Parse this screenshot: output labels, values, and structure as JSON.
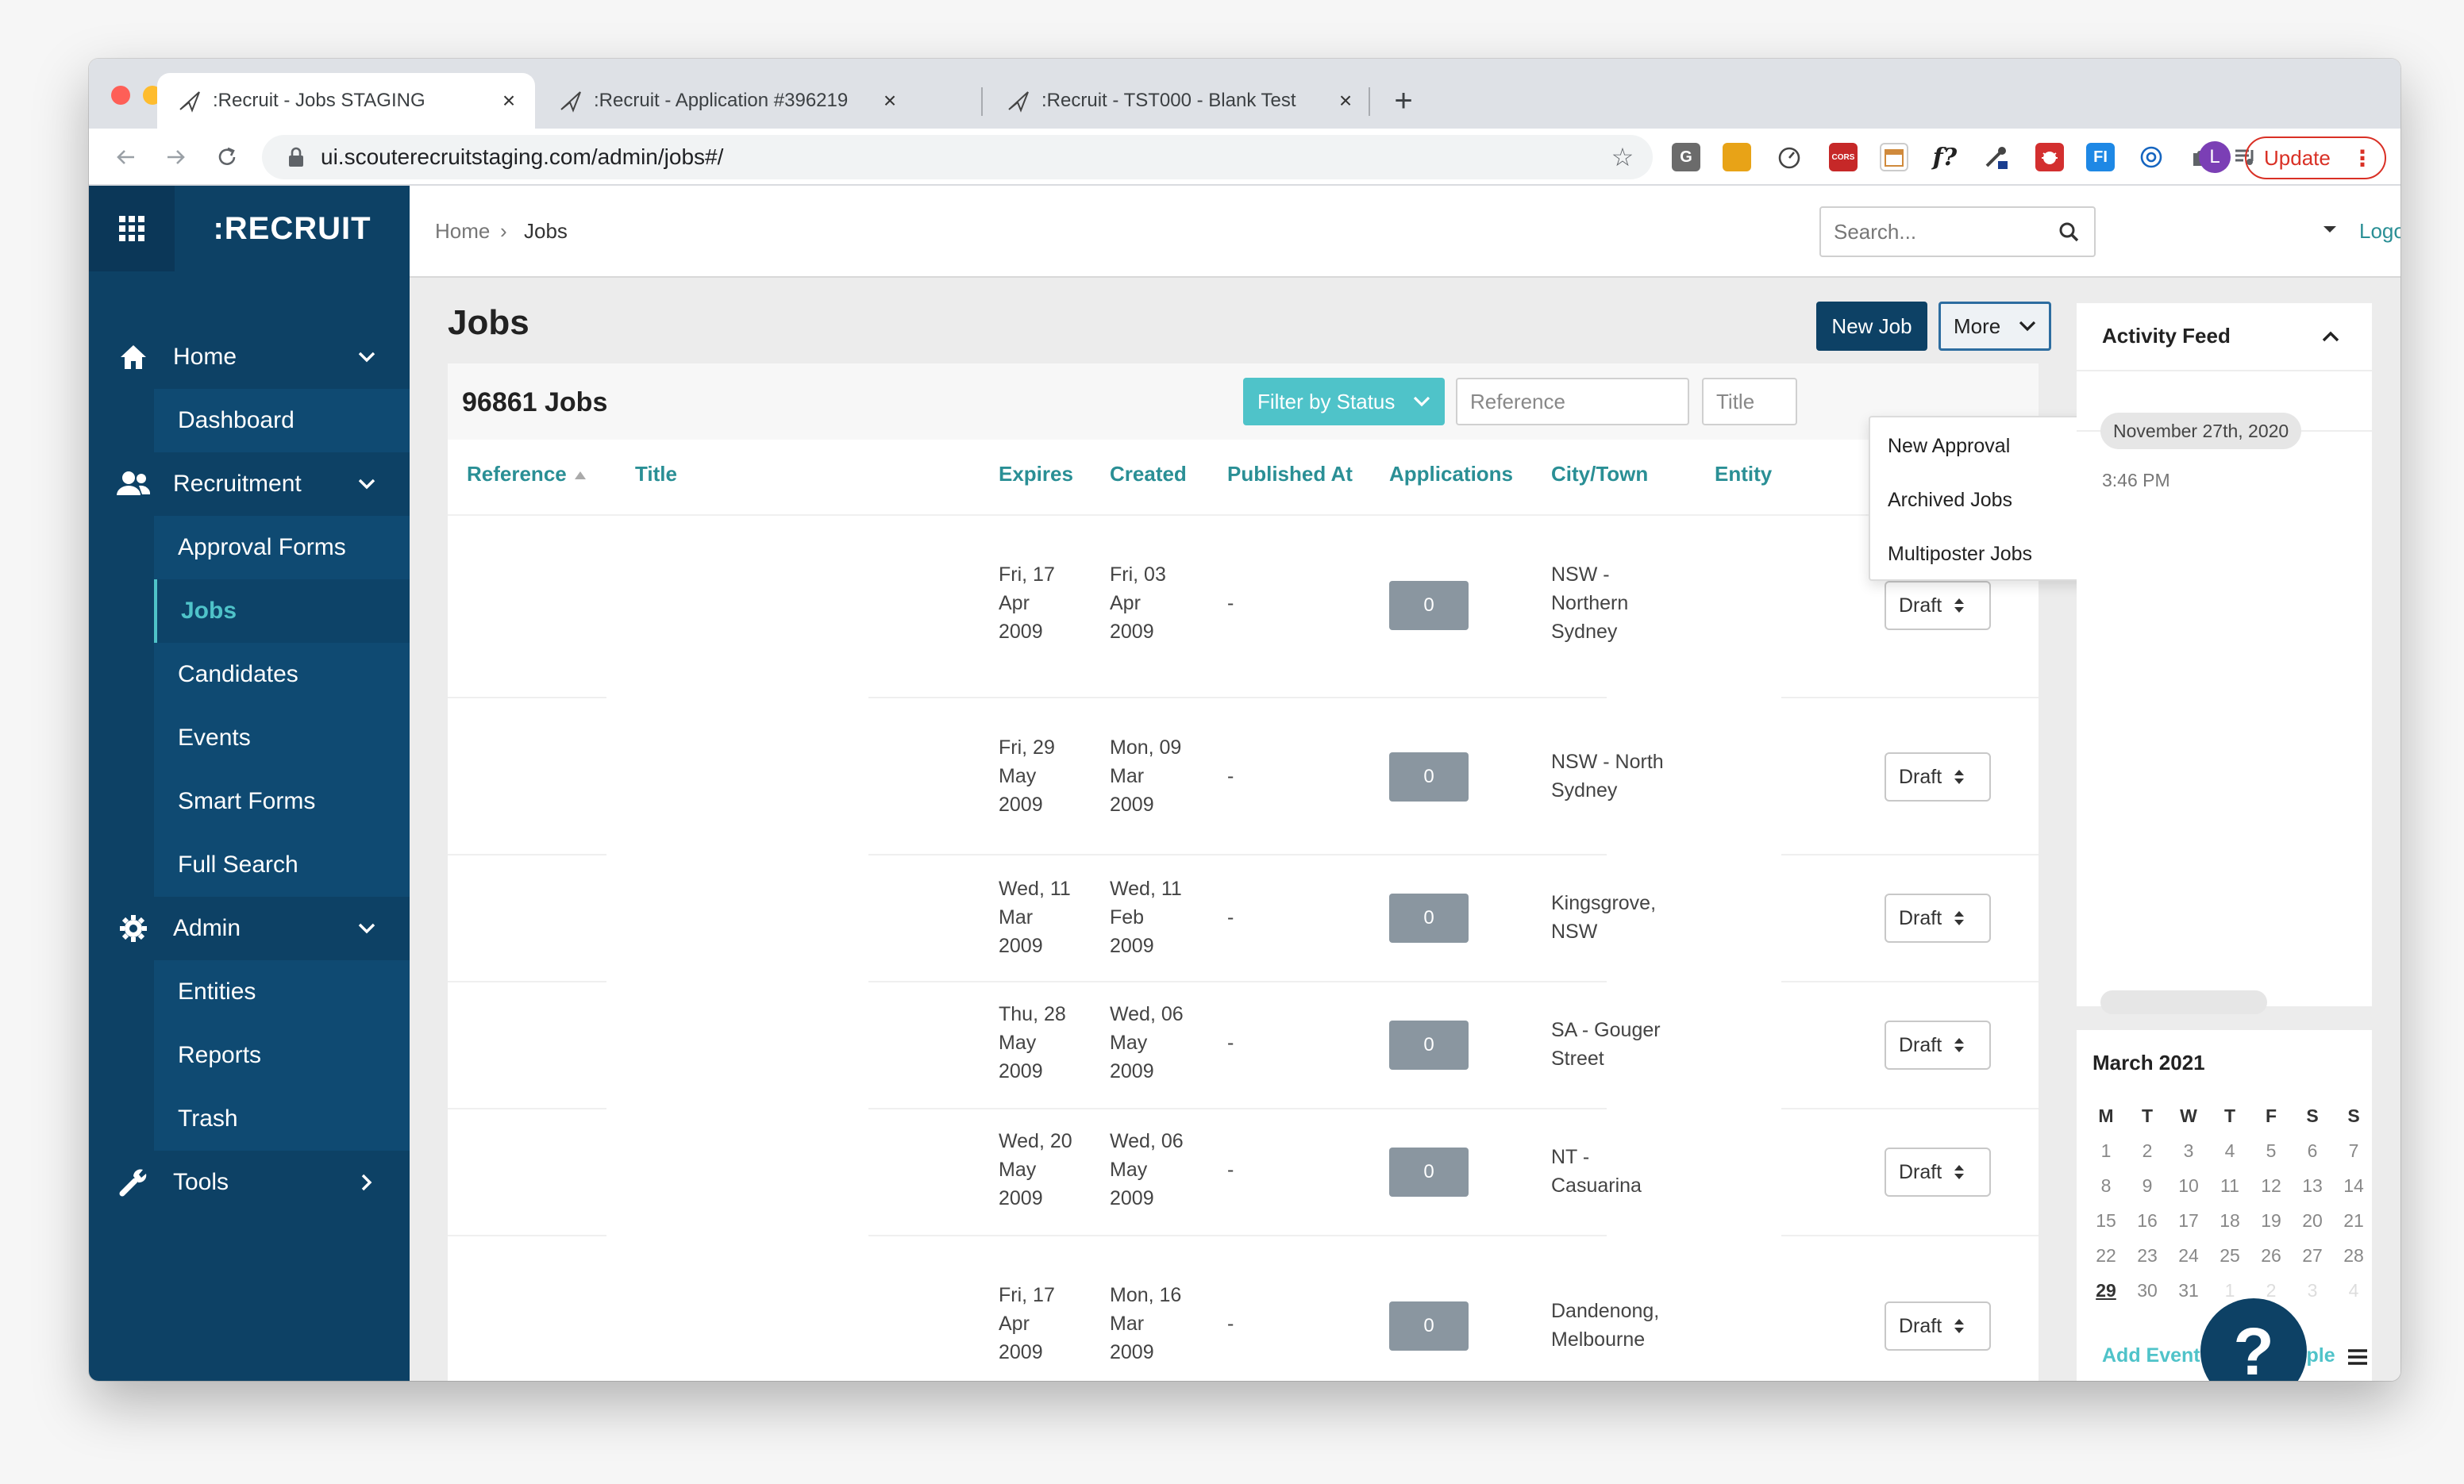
{
  "browser": {
    "tabs": [
      {
        "title": ":Recruit - Jobs STAGING",
        "active": true
      },
      {
        "title": ":Recruit - Application #396219",
        "active": false
      },
      {
        "title": ":Recruit - TST000 - Blank Test",
        "active": false
      }
    ],
    "url": "ui.scouterecruitstaging.com/admin/jobs#/",
    "profile_initial": "L",
    "update_label": "Update",
    "extensions": [
      {
        "name": "g-extension-icon",
        "label": "G",
        "color": "#6b6b6b"
      },
      {
        "name": "notes-extension-icon",
        "label": "",
        "color": "#e8a317"
      },
      {
        "name": "speed-extension-icon",
        "label": "",
        "color": "#ffffff"
      },
      {
        "name": "cors-extension-icon",
        "label": "CORS",
        "color": "#c62828"
      },
      {
        "name": "calendar-extension-icon",
        "label": "",
        "color": "#ffffff"
      },
      {
        "name": "formula-extension-icon",
        "label": "f?",
        "color": "#ffffff"
      },
      {
        "name": "eyedropper-extension-icon",
        "label": "",
        "color": "#ffffff"
      },
      {
        "name": "bug-extension-icon",
        "label": "",
        "color": "#d32f2f"
      },
      {
        "name": "fi-extension-icon",
        "label": "FI",
        "color": "#1e88e5"
      },
      {
        "name": "privacy-extension-icon",
        "label": "",
        "color": "#ffffff"
      },
      {
        "name": "puzzle-extension-icon",
        "label": "",
        "color": "#ffffff"
      },
      {
        "name": "playlist-extension-icon",
        "label": "",
        "color": "#ffffff"
      }
    ]
  },
  "sidebar": {
    "brand": ":RECRUIT",
    "sections": [
      {
        "label": "Home",
        "icon": "home-icon",
        "chevron": "down"
      },
      {
        "label": "Recruitment",
        "icon": "users-icon",
        "chevron": "down"
      },
      {
        "label": "Admin",
        "icon": "gear-icon",
        "chevron": "down"
      },
      {
        "label": "Tools",
        "icon": "wrench-icon",
        "chevron": "right"
      }
    ],
    "home_items": [
      "Dashboard"
    ],
    "recruitment_items": [
      "Approval Forms",
      "Jobs",
      "Candidates",
      "Events",
      "Smart Forms",
      "Full Search"
    ],
    "admin_items": [
      "Entities",
      "Reports",
      "Trash"
    ],
    "active_item": "Jobs"
  },
  "header": {
    "breadcrumb_home": "Home",
    "breadcrumb_sep": "›",
    "breadcrumb_current": "Jobs",
    "search_placeholder": "Search...",
    "logout_label": "Logout"
  },
  "jobs": {
    "title": "Jobs",
    "new_job_label": "New Job",
    "more_label": "More",
    "count_label": "96861 Jobs",
    "filter_label": "Filter by Status",
    "reference_placeholder": "Reference",
    "title_placeholder": "Title",
    "columns": [
      "Reference",
      "Title",
      "Expires",
      "Created",
      "Published At",
      "Applications",
      "City/Town",
      "Entity"
    ],
    "rows": [
      {
        "expires": "Fri, 17\nApr\n2009",
        "created": "Fri, 03\nApr\n2009",
        "published": "-",
        "applications": "0",
        "city": "NSW -\nNorthern\nSydney",
        "status": "Draft"
      },
      {
        "expires": "Fri, 29\nMay\n2009",
        "created": "Mon, 09\nMar\n2009",
        "published": "-",
        "applications": "0",
        "city": "NSW - North\nSydney",
        "status": "Draft"
      },
      {
        "expires": "Wed, 11\nMar\n2009",
        "created": "Wed, 11\nFeb\n2009",
        "published": "-",
        "applications": "0",
        "city": "Kingsgrove,\nNSW",
        "status": "Draft"
      },
      {
        "expires": "Thu, 28\nMay\n2009",
        "created": "Wed, 06\nMay\n2009",
        "published": "-",
        "applications": "0",
        "city": "SA - Gouger\nStreet",
        "status": "Draft"
      },
      {
        "expires": "Wed, 20\nMay\n2009",
        "created": "Wed, 06\nMay\n2009",
        "published": "-",
        "applications": "0",
        "city": "NT -\nCasuarina",
        "status": "Draft"
      },
      {
        "expires": "Fri, 17\nApr\n2009",
        "created": "Mon, 16\nMar\n2009",
        "published": "-",
        "applications": "0",
        "city": "Dandenong,\nMelbourne",
        "status": "Draft"
      }
    ],
    "more_menu": [
      "New Approval",
      "Archived Jobs",
      "Multiposter Jobs"
    ]
  },
  "activity": {
    "title": "Activity Feed",
    "date": "November 27th, 2020",
    "time": "3:46 PM"
  },
  "calendar": {
    "title": "March 2021",
    "weekdays": [
      "M",
      "T",
      "W",
      "T",
      "F",
      "S",
      "S"
    ],
    "weeks": [
      [
        "1",
        "2",
        "3",
        "4",
        "5",
        "6",
        "7"
      ],
      [
        "8",
        "9",
        "10",
        "11",
        "12",
        "13",
        "14"
      ],
      [
        "15",
        "16",
        "17",
        "18",
        "19",
        "20",
        "21"
      ],
      [
        "22",
        "23",
        "24",
        "25",
        "26",
        "27",
        "28"
      ],
      [
        "29",
        "30",
        "31",
        "1",
        "2",
        "3",
        "4"
      ]
    ],
    "today": "29",
    "add_event_label": "Add Event",
    "add_multiple_label": "Add Multiple",
    "help_label": "?"
  },
  "colors": {
    "sidebar": "#0d4165",
    "accent": "#4fc3c9",
    "link": "#2a8f95",
    "update": "#d93025"
  }
}
